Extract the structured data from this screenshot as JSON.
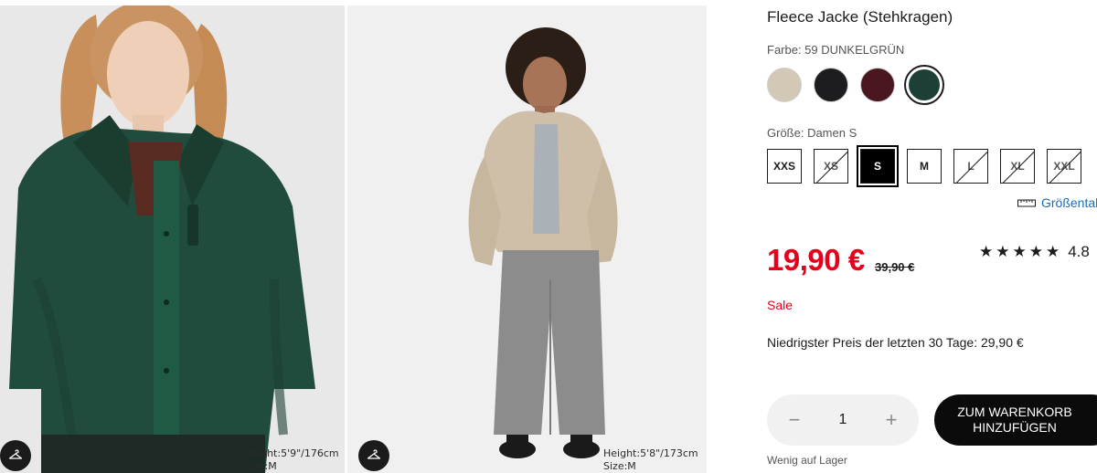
{
  "gallery": {
    "images": [
      {
        "alt": "Model in dark green fleece jacket",
        "caption_height": "Height:5'9\"/176cm",
        "caption_size": "Size:M",
        "hanger_icon": "hanger-icon"
      },
      {
        "alt": "Model in beige fleece jacket",
        "caption_height": "Height:5'8\"/173cm",
        "caption_size": "Size:M",
        "hanger_icon": "hanger-icon"
      }
    ]
  },
  "product": {
    "title": "Fleece Jacke (Stehkragen)",
    "color_label": "Farbe: 59 DUNKELGRÜN",
    "colors": [
      {
        "name": "beige",
        "hex": "#d3c8b6",
        "selected": false
      },
      {
        "name": "schwarz",
        "hex": "#1d1d1f",
        "selected": false
      },
      {
        "name": "weinrot",
        "hex": "#4a1620",
        "selected": false
      },
      {
        "name": "dunkelgrün",
        "hex": "#1d3f35",
        "selected": true
      }
    ],
    "size_label": "Größe: Damen S",
    "sizes": [
      {
        "label": "XXS",
        "available": true,
        "selected": false
      },
      {
        "label": "XS",
        "available": false,
        "selected": false
      },
      {
        "label": "S",
        "available": true,
        "selected": true
      },
      {
        "label": "M",
        "available": true,
        "selected": false
      },
      {
        "label": "L",
        "available": false,
        "selected": false
      },
      {
        "label": "XL",
        "available": false,
        "selected": false
      },
      {
        "label": "XXL",
        "available": false,
        "selected": false
      }
    ],
    "size_guide": "Größentabelle",
    "price": "19,90 €",
    "old_price": "39,90 €",
    "rating_stars": "★★★★★",
    "rating_value": "4.8",
    "sale": "Sale",
    "lowest_price": "Niedrigster Preis der letzten 30 Tage: 29,90 €",
    "quantity": "1",
    "qty_minus": "−",
    "qty_plus": "+",
    "add_to_cart_line1": "ZUM WARENKORB",
    "add_to_cart_line2": "HINZUFÜGEN",
    "stock": "Wenig auf Lager"
  },
  "colors": {
    "sale_red": "#e5001b",
    "link_blue": "#1b6bb4",
    "text": "#1b1b1b"
  }
}
